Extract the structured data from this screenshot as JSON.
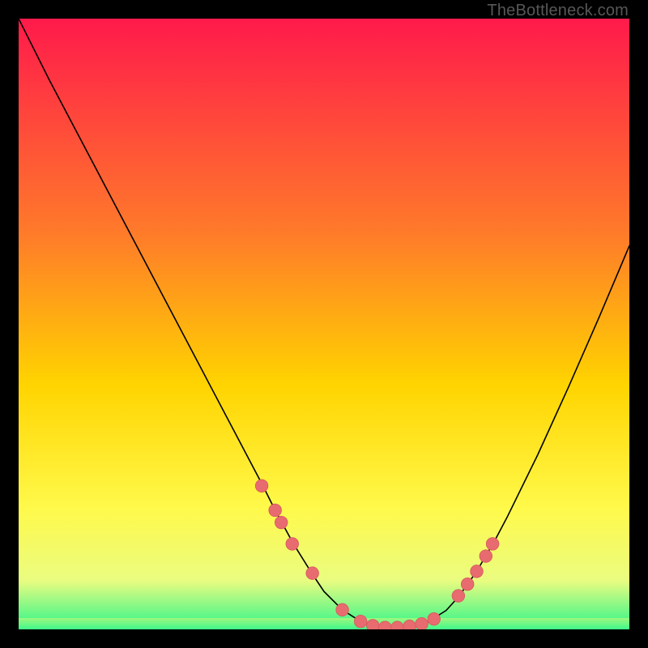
{
  "watermark": "TheBottleneck.com",
  "colors": {
    "gradient_top": "#ff1a4b",
    "gradient_mid1": "#ff7a2a",
    "gradient_mid2": "#ffd400",
    "gradient_mid3": "#fff94a",
    "gradient_mid4": "#eafc80",
    "gradient_bot": "#2bf58b",
    "curve": "#000000",
    "marker_fill": "#e86b6f",
    "marker_stroke": "#d65a5e"
  },
  "chart_data": {
    "type": "line",
    "title": "",
    "xlabel": "",
    "ylabel": "",
    "xlim": [
      0,
      100
    ],
    "ylim": [
      0,
      100
    ],
    "series": [
      {
        "name": "bottleneck-curve",
        "x": [
          0,
          5,
          10,
          15,
          20,
          25,
          30,
          35,
          40,
          42,
          45,
          48,
          50,
          53,
          56,
          58,
          60,
          63,
          65,
          67,
          70,
          72,
          75,
          78,
          80,
          85,
          90,
          95,
          100
        ],
        "y": [
          100,
          90,
          80.5,
          71,
          61.5,
          52,
          42.5,
          33,
          23.5,
          19.5,
          14,
          9.2,
          6.2,
          3.2,
          1.3,
          0.6,
          0.3,
          0.3,
          0.6,
          1.2,
          3.1,
          5.3,
          9.5,
          14.6,
          18.4,
          28.6,
          39.6,
          51,
          62.8
        ]
      }
    ],
    "markers": {
      "name": "sample-points",
      "x": [
        39.8,
        42.0,
        43.0,
        44.8,
        48.1,
        53.0,
        56.0,
        58.0,
        60.0,
        62.0,
        64.0,
        66.0,
        68.0,
        72.0,
        73.5,
        75.0,
        76.5,
        77.6
      ],
      "y": [
        23.5,
        19.5,
        17.5,
        14.0,
        9.2,
        3.2,
        1.3,
        0.6,
        0.3,
        0.3,
        0.5,
        0.9,
        1.7,
        5.5,
        7.4,
        9.5,
        12.0,
        14.0
      ]
    }
  }
}
